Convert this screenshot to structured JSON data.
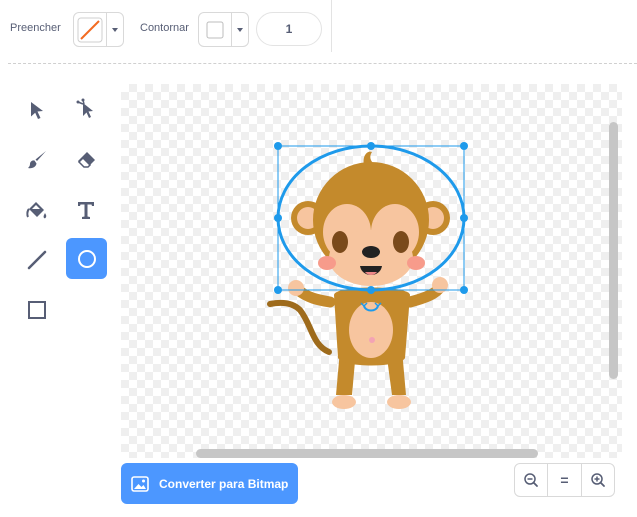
{
  "toolbar": {
    "fill_label": "Preencher",
    "outline_label": "Contornar",
    "outline_width": "1",
    "fill_color": "#f26b22",
    "outline_color": "#ffffff"
  },
  "tools": [
    {
      "name": "select",
      "icon": "select-arrow-icon"
    },
    {
      "name": "reshape",
      "icon": "reshape-icon"
    },
    {
      "name": "brush",
      "icon": "brush-icon"
    },
    {
      "name": "eraser",
      "icon": "eraser-icon"
    },
    {
      "name": "fill",
      "icon": "fill-bucket-icon"
    },
    {
      "name": "text",
      "icon": "text-icon",
      "glyph": "T"
    },
    {
      "name": "line",
      "icon": "line-icon"
    },
    {
      "name": "circle",
      "icon": "circle-icon",
      "active": true
    },
    {
      "name": "rectangle",
      "icon": "rectangle-icon"
    }
  ],
  "convert_button": {
    "label": "Converter para Bitmap",
    "icon": "image-icon"
  },
  "zoom": {
    "out_icon": "zoom-out-icon",
    "reset_icon": "zoom-reset-icon",
    "reset_glyph": "=",
    "in_icon": "zoom-in-icon"
  },
  "colors": {
    "accent": "#4c97ff",
    "selection": "#1e9aeb",
    "text": "#575e75"
  }
}
